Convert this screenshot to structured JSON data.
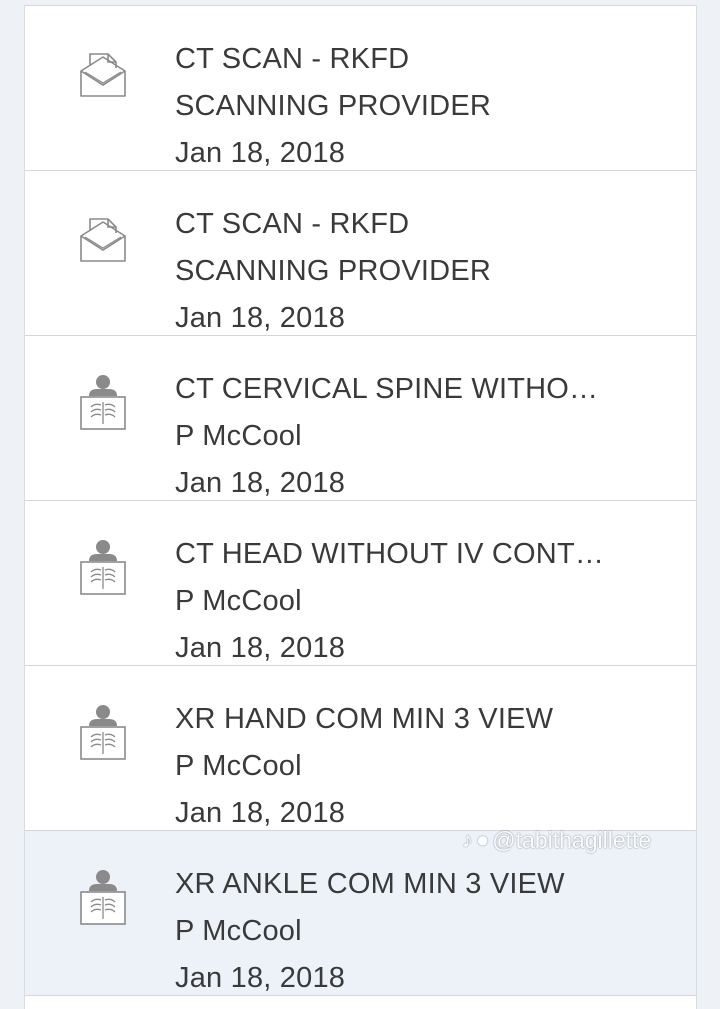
{
  "records": [
    {
      "icon": "envelope-document-icon",
      "title": "CT SCAN - RKFD",
      "subtitle": "SCANNING PROVIDER",
      "date": "Jan 18, 2018",
      "selected": false
    },
    {
      "icon": "envelope-document-icon",
      "title": "CT SCAN - RKFD",
      "subtitle": "SCANNING PROVIDER",
      "date": "Jan 18, 2018",
      "selected": false
    },
    {
      "icon": "xray-person-icon",
      "title": "CT CERVICAL SPINE WITHOU…",
      "subtitle": "P McCool",
      "date": "Jan 18, 2018",
      "selected": false
    },
    {
      "icon": "xray-person-icon",
      "title": "CT HEAD WITHOUT IV CONTR…",
      "subtitle": "P McCool",
      "date": "Jan 18, 2018",
      "selected": false
    },
    {
      "icon": "xray-person-icon",
      "title": "XR HAND COM MIN 3 VIEW",
      "subtitle": "P McCool",
      "date": "Jan 18, 2018",
      "selected": false
    },
    {
      "icon": "xray-person-icon",
      "title": "XR ANKLE COM MIN 3 VIEW",
      "subtitle": "P McCool",
      "date": "Jan 18, 2018",
      "selected": true
    }
  ],
  "watermark": {
    "text": "@tabithagillette",
    "icons": [
      "tiktok-logo-icon",
      "user-icon"
    ]
  },
  "colors": {
    "page_background": "#eef2f7",
    "row_background": "#ffffff",
    "selected_row_background": "#edf2f9",
    "divider": "#d3d7dd",
    "text": "#3a3a3a",
    "icon": "#8a8a8a"
  }
}
